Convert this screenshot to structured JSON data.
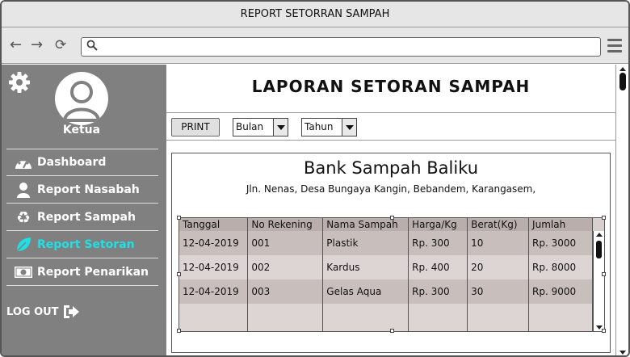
{
  "window": {
    "title": "REPORT SETORRAN SAMPAH"
  },
  "sidebar": {
    "role": "Ketua",
    "items": [
      {
        "label": "Dashboard",
        "icon": "dashboard-icon"
      },
      {
        "label": "Report  Nasabah",
        "icon": "user-icon"
      },
      {
        "label": "Report Sampah",
        "icon": "recycle-icon"
      },
      {
        "label": "Report Setoran",
        "icon": "leaf-icon",
        "active": true
      },
      {
        "label": "Report Penarikan",
        "icon": "money-icon"
      }
    ],
    "logout": "LOG OUT"
  },
  "main": {
    "title": "LAPORAN SETORAN SAMPAH",
    "print": "PRINT",
    "month_select": "Bulan",
    "year_select": "Tahun"
  },
  "report": {
    "org": "Bank Sampah Baliku",
    "address": "Jln. Nenas, Desa Bungaya Kangin, Bebandem, Karangasem,",
    "columns": [
      "Tanggal",
      "No Rekening",
      "Nama Sampah",
      "Harga/Kg",
      "Berat(Kg)",
      "Jumlah"
    ],
    "rows": [
      [
        "12-04-2019",
        "001",
        "Plastik",
        "Rp. 300",
        "10",
        "Rp. 3000"
      ],
      [
        "12-04-2019",
        "002",
        "Kardus",
        "Rp. 400",
        "20",
        "Rp. 8000"
      ],
      [
        "12-04-2019",
        "003",
        "Gelas Aqua",
        "Rp. 300",
        "30",
        "Rp. 9000"
      ]
    ]
  },
  "colors": {
    "sidebar_bg": "#808080",
    "active_item": "#1ee0e6",
    "table_header": "#b9aeac"
  }
}
